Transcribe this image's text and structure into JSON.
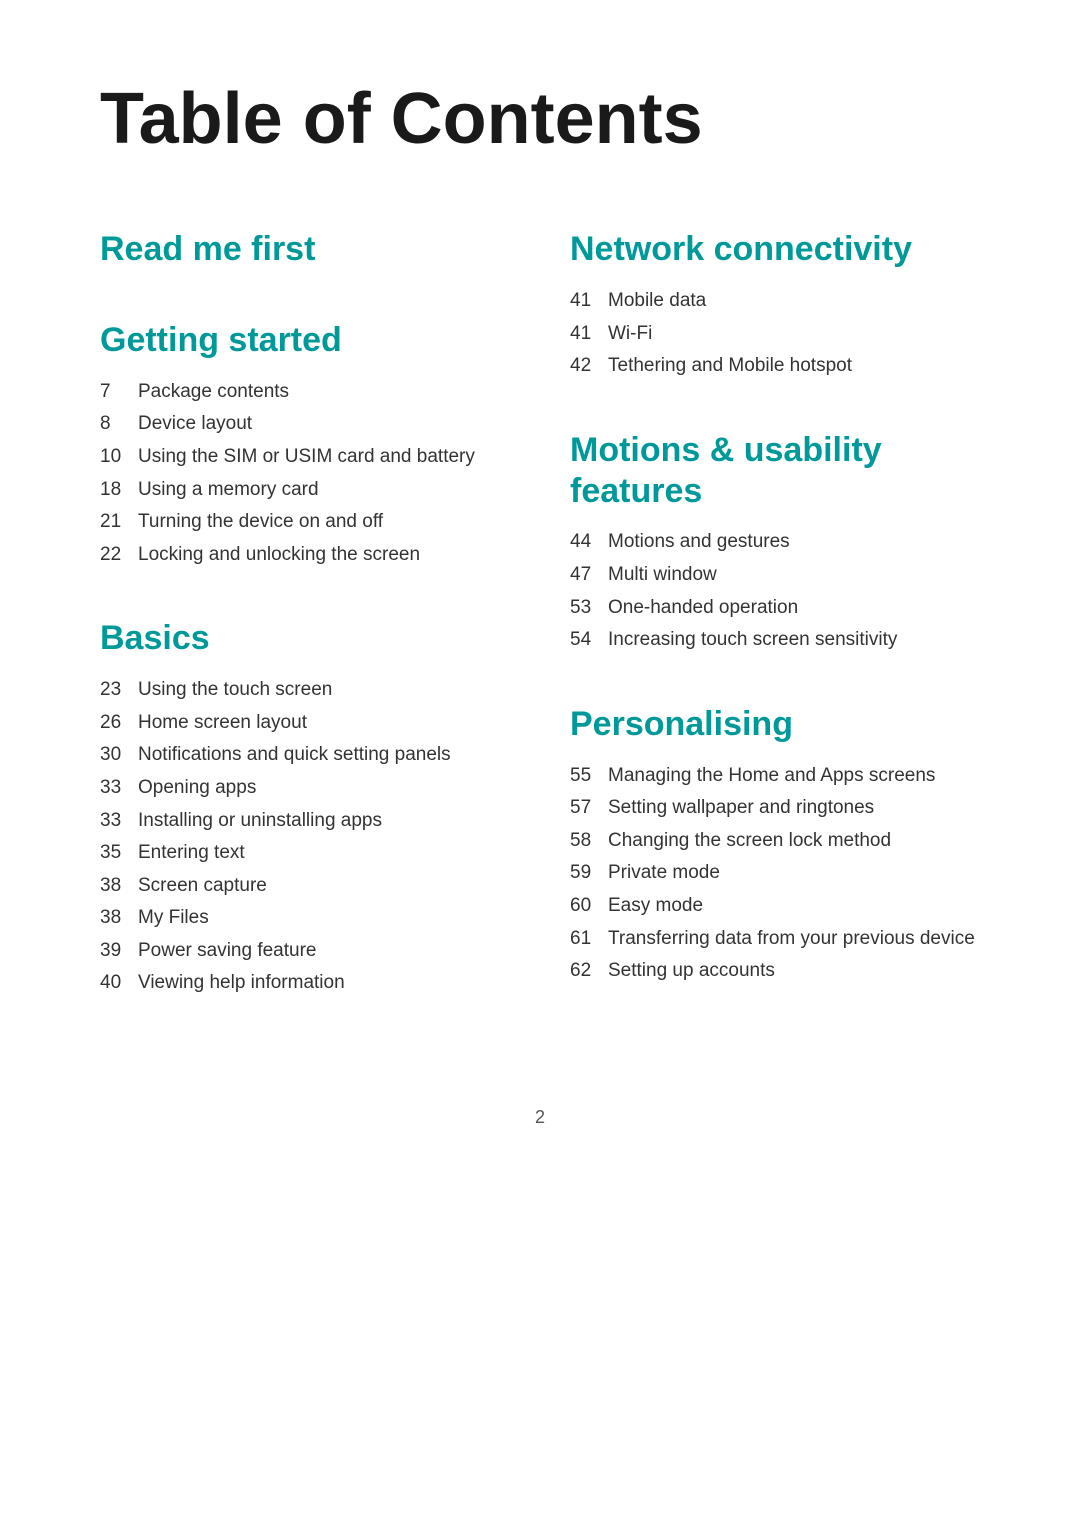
{
  "title": "Table of Contents",
  "sections": {
    "left": [
      {
        "id": "read-me-first",
        "title": "Read me first",
        "items": []
      },
      {
        "id": "getting-started",
        "title": "Getting started",
        "items": [
          {
            "page": "7",
            "text": "Package contents"
          },
          {
            "page": "8",
            "text": "Device layout"
          },
          {
            "page": "10",
            "text": "Using the SIM or USIM card and battery"
          },
          {
            "page": "18",
            "text": "Using a memory card"
          },
          {
            "page": "21",
            "text": "Turning the device on and off"
          },
          {
            "page": "22",
            "text": "Locking and unlocking the screen"
          }
        ]
      },
      {
        "id": "basics",
        "title": "Basics",
        "items": [
          {
            "page": "23",
            "text": "Using the touch screen"
          },
          {
            "page": "26",
            "text": "Home screen layout"
          },
          {
            "page": "30",
            "text": "Notifications and quick setting panels"
          },
          {
            "page": "33",
            "text": "Opening apps"
          },
          {
            "page": "33",
            "text": "Installing or uninstalling apps"
          },
          {
            "page": "35",
            "text": "Entering text"
          },
          {
            "page": "38",
            "text": "Screen capture"
          },
          {
            "page": "38",
            "text": "My Files"
          },
          {
            "page": "39",
            "text": "Power saving feature"
          },
          {
            "page": "40",
            "text": "Viewing help information"
          }
        ]
      }
    ],
    "right": [
      {
        "id": "network-connectivity",
        "title": "Network connectivity",
        "items": [
          {
            "page": "41",
            "text": "Mobile data"
          },
          {
            "page": "41",
            "text": "Wi-Fi"
          },
          {
            "page": "42",
            "text": "Tethering and Mobile hotspot"
          }
        ]
      },
      {
        "id": "motions-usability",
        "title": "Motions & usability features",
        "items": [
          {
            "page": "44",
            "text": "Motions and gestures"
          },
          {
            "page": "47",
            "text": "Multi window"
          },
          {
            "page": "53",
            "text": "One-handed operation"
          },
          {
            "page": "54",
            "text": "Increasing touch screen sensitivity"
          }
        ]
      },
      {
        "id": "personalising",
        "title": "Personalising",
        "items": [
          {
            "page": "55",
            "text": "Managing the Home and Apps screens"
          },
          {
            "page": "57",
            "text": "Setting wallpaper and ringtones"
          },
          {
            "page": "58",
            "text": "Changing the screen lock method"
          },
          {
            "page": "59",
            "text": "Private mode"
          },
          {
            "page": "60",
            "text": "Easy mode"
          },
          {
            "page": "61",
            "text": "Transferring data from your previous device"
          },
          {
            "page": "62",
            "text": "Setting up accounts"
          }
        ]
      }
    ]
  },
  "footer": {
    "page_number": "2"
  }
}
